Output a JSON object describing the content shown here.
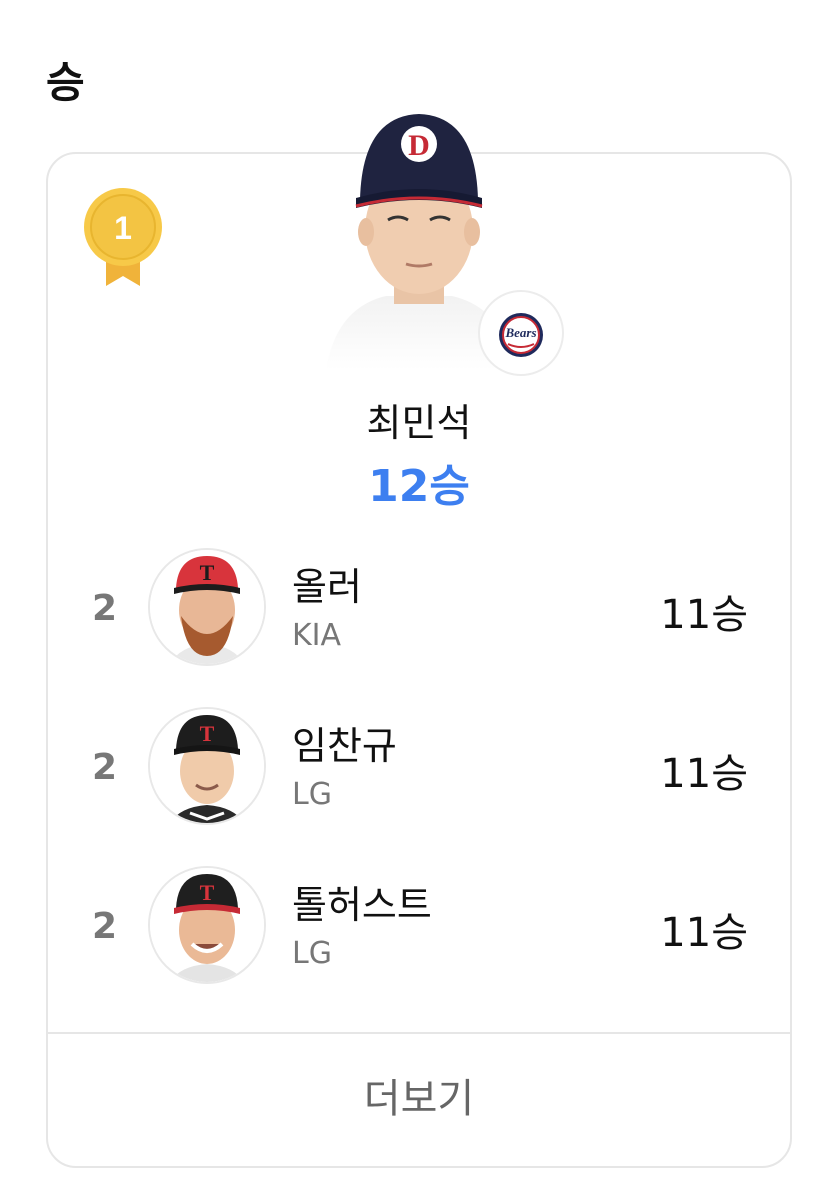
{
  "section": {
    "title": "승"
  },
  "leader": {
    "rank": "1",
    "name": "최민석",
    "stat": "12승",
    "team_logo_text": "Bears"
  },
  "others": [
    {
      "rank": "2",
      "name": "올러",
      "team": "KIA",
      "stat": "11승"
    },
    {
      "rank": "2",
      "name": "임찬규",
      "team": "LG",
      "stat": "11승"
    },
    {
      "rank": "2",
      "name": "톨허스트",
      "team": "LG",
      "stat": "11승"
    }
  ],
  "footer": {
    "more_label": "더보기"
  },
  "colors": {
    "accent": "#3d7ff0",
    "medal_gold": "#f3c443",
    "medal_ribbon": "#f0b33a",
    "card_border": "#e6e6e6"
  }
}
